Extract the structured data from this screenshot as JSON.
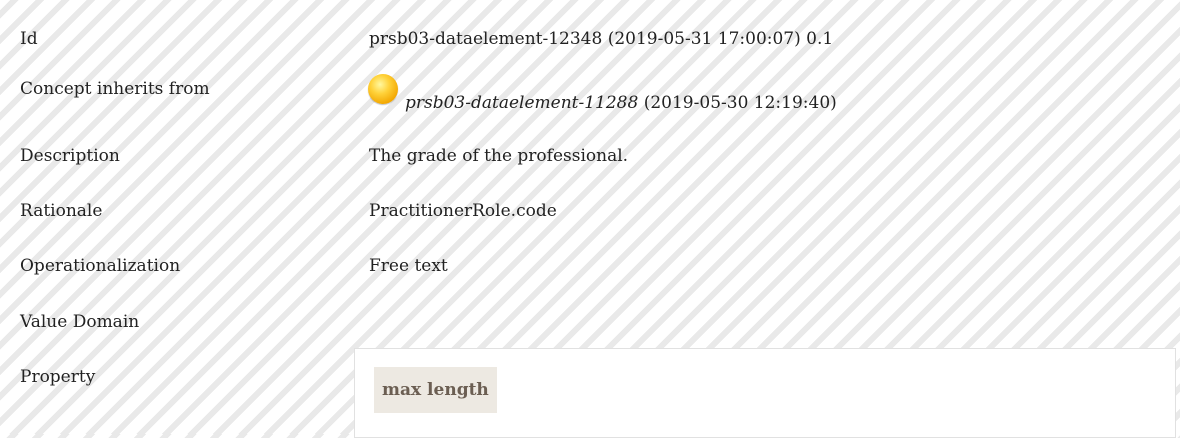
{
  "rows": [
    {
      "label": "Id",
      "value": "prsb03-dataelement-12348 (2019-05-31 17:00:07) 0.1"
    },
    {
      "label": "Concept inherits from",
      "link": "prsb03-dataelement-11288",
      "value_suffix": " (2019-05-30 12:19:40)",
      "icon": "concept-status-circle-icon"
    },
    {
      "label": "Description",
      "value": "The grade of the professional."
    },
    {
      "label": "Rationale",
      "value": "PractitionerRole.code"
    },
    {
      "label": "Operationalization",
      "value": "Free text"
    },
    {
      "label": "Value Domain",
      "value": ""
    },
    {
      "label": "Property",
      "property_chip": "max length"
    }
  ]
}
